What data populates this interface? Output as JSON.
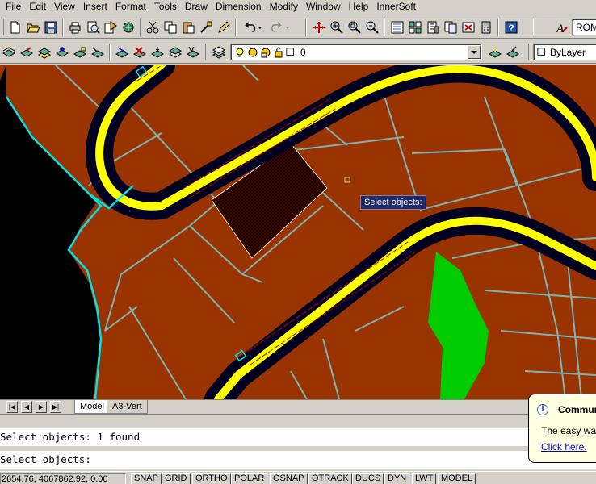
{
  "menu": [
    "File",
    "Edit",
    "View",
    "Insert",
    "Format",
    "Tools",
    "Draw",
    "Dimension",
    "Modify",
    "Window",
    "Help",
    "InnerSoft"
  ],
  "toolbar1": {
    "text_style_value": "ROM",
    "icons": [
      "new-icon",
      "open-icon",
      "save-icon",
      "plot-icon",
      "plot-preview-icon",
      "publish-icon",
      "cut-icon",
      "copy-icon",
      "paste-icon",
      "match-properties-icon",
      "block-editor-icon",
      "undo-icon",
      "redo-icon",
      "pan-icon",
      "zoom-realtime-icon",
      "zoom-window-icon",
      "zoom-previous-icon",
      "properties-icon",
      "design-center-icon",
      "tool-palettes-icon",
      "sheet-set-icon",
      "markup-icon",
      "calculator-icon",
      "help-icon",
      "text-style-icon"
    ]
  },
  "toolbar2": {
    "layer_value": "0",
    "color_value": "ByLayer",
    "icons": [
      "layer-states-icon",
      "layer-previous-icon",
      "layer-isolate-icon",
      "layer-freeze-icon",
      "layer-lock-icon",
      "layer-match-icon",
      "layer-delete-icon",
      "layer-walk-icon",
      "layer-merge-icon",
      "layer-manager-icon",
      "make-current-icon",
      "layer-previous-2-icon"
    ]
  },
  "drawing": {
    "tooltip": "Select objects:"
  },
  "tabs": {
    "items": [
      "Model",
      "A3-Vert"
    ],
    "active": "Model"
  },
  "command": {
    "line1": "Select objects: 1 found",
    "line2": "Select objects:"
  },
  "status": {
    "coords": "2654.76, 4067862.92, 0.00",
    "buttons": [
      "SNAP",
      "GRID",
      "ORTHO",
      "POLAR",
      "OSNAP",
      "OTRACK",
      "DUCS",
      "DYN",
      "LWT",
      "MODEL"
    ]
  },
  "balloon": {
    "title": "Commun",
    "text": "The easy way",
    "link": "Click here."
  },
  "colors": {
    "drawing_bg": "#993300",
    "road_fill": "#ffff00",
    "road_border": "#000020",
    "parcel_lines": "#7fb2b2",
    "cyan_boundary": "#00e5e5",
    "selection_hatch": "#330000",
    "green_area": "#00cc00",
    "left_area": "#000000"
  }
}
